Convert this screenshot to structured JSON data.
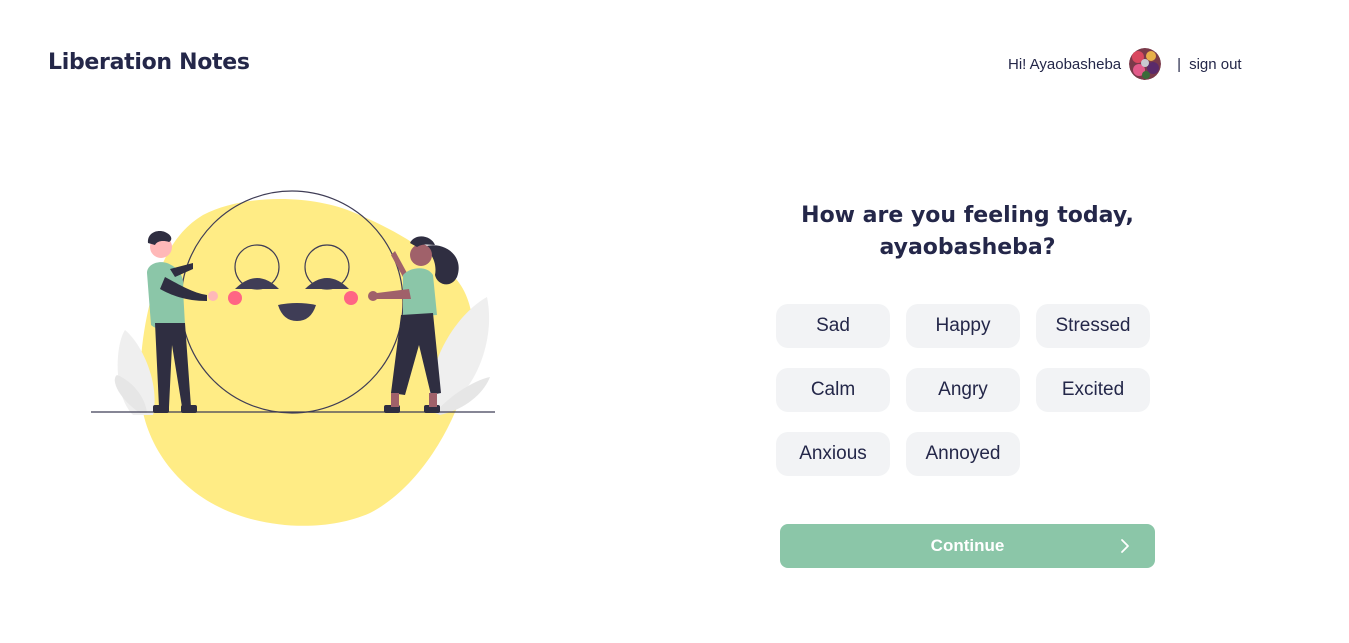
{
  "header": {
    "app_name": "Liberation Notes",
    "greeting": "Hi! Ayaobasheba",
    "separator": "|",
    "sign_out": "sign out"
  },
  "question": {
    "line1": "How are you feeling today,",
    "line2": "ayaobasheba?"
  },
  "moods": [
    "Sad",
    "Happy",
    "Stressed",
    "Calm",
    "Angry",
    "Excited",
    "Anxious",
    "Annoyed"
  ],
  "continue_label": "Continue",
  "icons": {
    "continue": "chevron-right-icon",
    "avatar": "avatar"
  },
  "colors": {
    "brand_text": "#242749",
    "continue_bg": "#8bc6a8",
    "mood_bg": "#f2f3f5",
    "blob": "#ffec85"
  }
}
